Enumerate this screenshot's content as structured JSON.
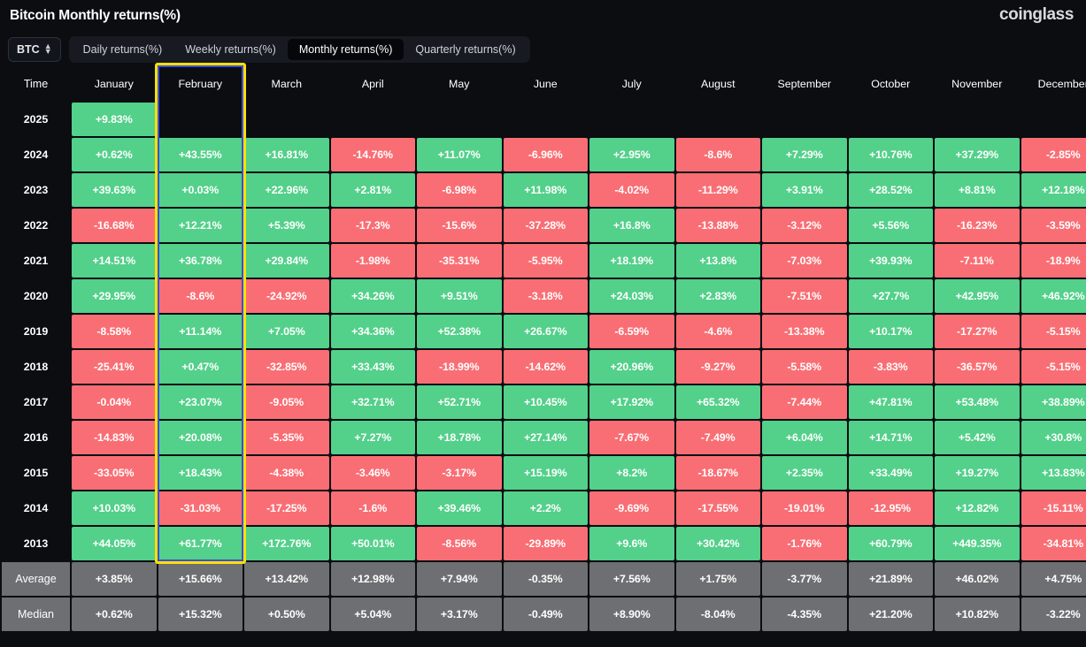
{
  "header": {
    "title": "Bitcoin Monthly returns(%)",
    "brand": "coinglass"
  },
  "controls": {
    "symbol": "BTC",
    "tabs": [
      {
        "label": "Daily returns(%)",
        "active": false
      },
      {
        "label": "Weekly returns(%)",
        "active": false
      },
      {
        "label": "Monthly returns(%)",
        "active": true
      },
      {
        "label": "Quarterly returns(%)",
        "active": false
      }
    ]
  },
  "highlight": {
    "column": "February",
    "border_color": "#ffe000",
    "inner_color": "#3b4fd8"
  },
  "colors": {
    "positive": "#53d08a",
    "negative": "#f96e74",
    "stat": "#6d6f72",
    "background": "#0b0d11"
  },
  "chart_data": {
    "type": "heatmap",
    "title": "Bitcoin Monthly returns(%)",
    "xlabel": "",
    "ylabel": "Time",
    "columns": [
      "Time",
      "January",
      "February",
      "March",
      "April",
      "May",
      "June",
      "July",
      "August",
      "September",
      "October",
      "November",
      "December"
    ],
    "categories": [
      "January",
      "February",
      "March",
      "April",
      "May",
      "June",
      "July",
      "August",
      "September",
      "October",
      "November",
      "December"
    ],
    "rows": [
      {
        "year": "2025",
        "values": [
          "+9.83%",
          "",
          "",
          "",
          "",
          "",
          "",
          "",
          "",
          "",
          "",
          ""
        ]
      },
      {
        "year": "2024",
        "values": [
          "+0.62%",
          "+43.55%",
          "+16.81%",
          "-14.76%",
          "+11.07%",
          "-6.96%",
          "+2.95%",
          "-8.6%",
          "+7.29%",
          "+10.76%",
          "+37.29%",
          "-2.85%"
        ]
      },
      {
        "year": "2023",
        "values": [
          "+39.63%",
          "+0.03%",
          "+22.96%",
          "+2.81%",
          "-6.98%",
          "+11.98%",
          "-4.02%",
          "-11.29%",
          "+3.91%",
          "+28.52%",
          "+8.81%",
          "+12.18%"
        ]
      },
      {
        "year": "2022",
        "values": [
          "-16.68%",
          "+12.21%",
          "+5.39%",
          "-17.3%",
          "-15.6%",
          "-37.28%",
          "+16.8%",
          "-13.88%",
          "-3.12%",
          "+5.56%",
          "-16.23%",
          "-3.59%"
        ]
      },
      {
        "year": "2021",
        "values": [
          "+14.51%",
          "+36.78%",
          "+29.84%",
          "-1.98%",
          "-35.31%",
          "-5.95%",
          "+18.19%",
          "+13.8%",
          "-7.03%",
          "+39.93%",
          "-7.11%",
          "-18.9%"
        ]
      },
      {
        "year": "2020",
        "values": [
          "+29.95%",
          "-8.6%",
          "-24.92%",
          "+34.26%",
          "+9.51%",
          "-3.18%",
          "+24.03%",
          "+2.83%",
          "-7.51%",
          "+27.7%",
          "+42.95%",
          "+46.92%"
        ]
      },
      {
        "year": "2019",
        "values": [
          "-8.58%",
          "+11.14%",
          "+7.05%",
          "+34.36%",
          "+52.38%",
          "+26.67%",
          "-6.59%",
          "-4.6%",
          "-13.38%",
          "+10.17%",
          "-17.27%",
          "-5.15%"
        ]
      },
      {
        "year": "2018",
        "values": [
          "-25.41%",
          "+0.47%",
          "-32.85%",
          "+33.43%",
          "-18.99%",
          "-14.62%",
          "+20.96%",
          "-9.27%",
          "-5.58%",
          "-3.83%",
          "-36.57%",
          "-5.15%"
        ]
      },
      {
        "year": "2017",
        "values": [
          "-0.04%",
          "+23.07%",
          "-9.05%",
          "+32.71%",
          "+52.71%",
          "+10.45%",
          "+17.92%",
          "+65.32%",
          "-7.44%",
          "+47.81%",
          "+53.48%",
          "+38.89%"
        ]
      },
      {
        "year": "2016",
        "values": [
          "-14.83%",
          "+20.08%",
          "-5.35%",
          "+7.27%",
          "+18.78%",
          "+27.14%",
          "-7.67%",
          "-7.49%",
          "+6.04%",
          "+14.71%",
          "+5.42%",
          "+30.8%"
        ]
      },
      {
        "year": "2015",
        "values": [
          "-33.05%",
          "+18.43%",
          "-4.38%",
          "-3.46%",
          "-3.17%",
          "+15.19%",
          "+8.2%",
          "-18.67%",
          "+2.35%",
          "+33.49%",
          "+19.27%",
          "+13.83%"
        ]
      },
      {
        "year": "2014",
        "values": [
          "+10.03%",
          "-31.03%",
          "-17.25%",
          "-1.6%",
          "+39.46%",
          "+2.2%",
          "-9.69%",
          "-17.55%",
          "-19.01%",
          "-12.95%",
          "+12.82%",
          "-15.11%"
        ]
      },
      {
        "year": "2013",
        "values": [
          "+44.05%",
          "+61.77%",
          "+172.76%",
          "+50.01%",
          "-8.56%",
          "-29.89%",
          "+9.6%",
          "+30.42%",
          "-1.76%",
          "+60.79%",
          "+449.35%",
          "-34.81%"
        ]
      }
    ],
    "summary": [
      {
        "label": "Average",
        "values": [
          "+3.85%",
          "+15.66%",
          "+13.42%",
          "+12.98%",
          "+7.94%",
          "-0.35%",
          "+7.56%",
          "+1.75%",
          "-3.77%",
          "+21.89%",
          "+46.02%",
          "+4.75%"
        ]
      },
      {
        "label": "Median",
        "values": [
          "+0.62%",
          "+15.32%",
          "+0.50%",
          "+5.04%",
          "+3.17%",
          "-0.49%",
          "+8.90%",
          "-8.04%",
          "-4.35%",
          "+21.20%",
          "+10.82%",
          "-3.22%"
        ]
      }
    ]
  }
}
